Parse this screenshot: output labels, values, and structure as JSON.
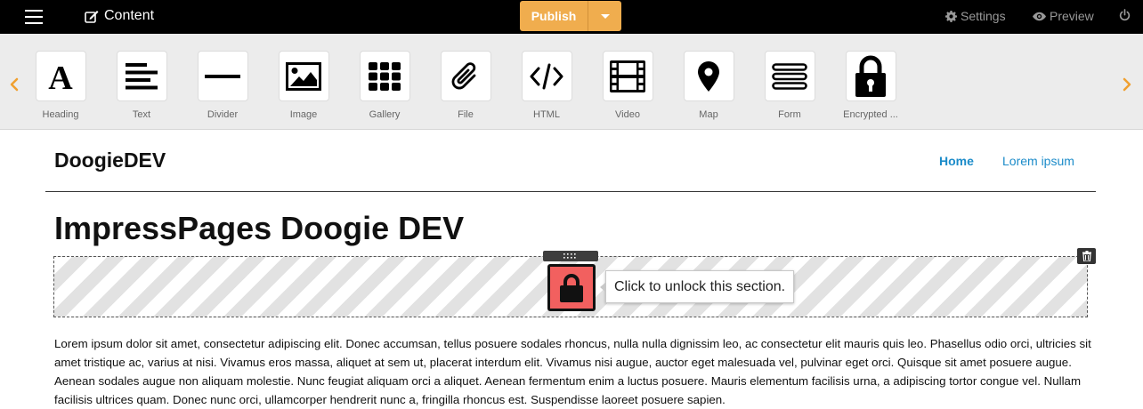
{
  "topbar": {
    "content_label": "Content",
    "publish_label": "Publish",
    "settings_label": "Settings",
    "preview_label": "Preview"
  },
  "widgets": [
    {
      "label": "Heading",
      "icon": "heading-icon"
    },
    {
      "label": "Text",
      "icon": "text-icon"
    },
    {
      "label": "Divider",
      "icon": "divider-icon"
    },
    {
      "label": "Image",
      "icon": "image-icon"
    },
    {
      "label": "Gallery",
      "icon": "gallery-icon"
    },
    {
      "label": "File",
      "icon": "paperclip-icon"
    },
    {
      "label": "HTML",
      "icon": "code-icon"
    },
    {
      "label": "Video",
      "icon": "film-icon"
    },
    {
      "label": "Map",
      "icon": "map-marker-icon"
    },
    {
      "label": "Form",
      "icon": "form-icon"
    },
    {
      "label": "Encrypted ...",
      "icon": "lock-icon"
    }
  ],
  "site": {
    "name": "DoogieDEV",
    "nav": [
      "Home",
      "Lorem ipsum"
    ]
  },
  "page": {
    "title": "ImpressPages Doogie DEV",
    "unlock_text": "Click to unlock this section.",
    "body": "Lorem ipsum dolor sit amet, consectetur adipiscing elit. Donec accumsan, tellus posuere sodales rhoncus, nulla nulla dignissim leo, ac consectetur elit mauris quis leo. Phasellus odio orci, ultricies sit amet tristique ac, varius at nisi. Vivamus eros massa, aliquet at sem ut, placerat interdum elit. Vivamus nisi augue, auctor eget malesuada vel, pulvinar eget orci. Quisque sit amet posuere augue. Aenean sodales augue non aliquam molestie. Nunc feugiat aliquam orci a aliquet. Aenean fermentum enim a luctus posuere. Mauris elementum facilisis urna, a adipiscing tortor congue vel. Nullam facilisis ultrices quam. Donec nunc orci, ullamcorper hendrerit nunc a, fringilla rhoncus est. Suspendisse laoreet posuere sapien."
  },
  "colors": {
    "publish": "#f0ad4e",
    "link": "#1b8bc9",
    "lock_button": "#f2605f",
    "nav_arrow": "#f0a030"
  }
}
